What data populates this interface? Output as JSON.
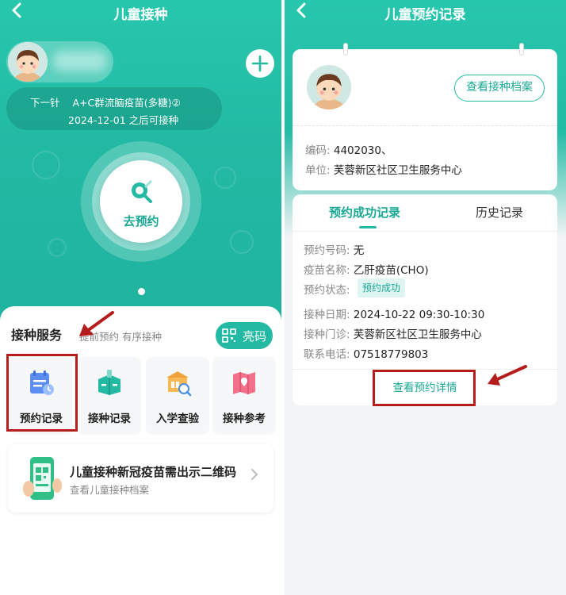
{
  "colors": {
    "brand": "#23b9a2",
    "highlight_box": "#b51d1d",
    "page_bg": "#f3f4f6"
  },
  "left": {
    "nav": {
      "title": "儿童接种",
      "back_icon": "chevron-left-icon"
    },
    "next_dose": {
      "prefix": "下一针",
      "vaccine": "A+C群流脑疫苗(多糖)②",
      "date_text": "2024-12-01 之后可接种"
    },
    "add_icon": "plus-icon",
    "main_action": {
      "label": "去预约",
      "icon": "search-syringe-icon"
    },
    "service": {
      "title": "接种服务",
      "subtitle": "提前预约 有序接种",
      "qr_button": "亮码",
      "tiles": [
        {
          "label": "预约记录",
          "icon": "calendar-record-icon"
        },
        {
          "label": "接种记录",
          "icon": "vaccine-record-icon"
        },
        {
          "label": "入学查验",
          "icon": "school-check-icon"
        },
        {
          "label": "接种参考",
          "icon": "map-reference-icon"
        }
      ]
    },
    "covid_card": {
      "title": "儿童接种新冠疫苗需出示二维码",
      "subtitle": "查看儿童接种档案",
      "icon": "phone-qr-icon"
    }
  },
  "right": {
    "nav": {
      "title": "儿童预约记录",
      "back_icon": "chevron-left-icon"
    },
    "profile": {
      "archive_button": "查看接种档案",
      "code_label": "编码:",
      "code_value": "4402030、",
      "unit_label": "单位:",
      "unit_value": "芙蓉新区社区卫生服务中心"
    },
    "tabs": [
      "预约成功记录",
      "历史记录"
    ],
    "record": {
      "rows": [
        {
          "label": "预约号码:",
          "value": "无"
        },
        {
          "label": "疫苗名称:",
          "value": "乙肝疫苗(CHO)"
        },
        {
          "label": "预约状态:",
          "value": ""
        },
        {
          "label": "接种日期:",
          "value": "2024-10-22 09:30-10:30"
        },
        {
          "label": "接种门诊:",
          "value": "芙蓉新区社区卫生服务中心"
        },
        {
          "label": "联系电话:",
          "value": "07518779803"
        }
      ],
      "status_badge": "预约成功",
      "detail_link": "查看预约详情"
    }
  }
}
